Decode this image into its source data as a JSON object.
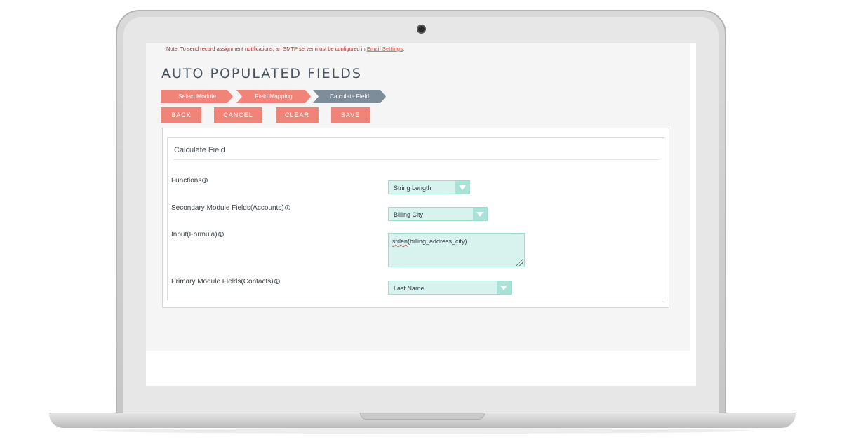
{
  "note": {
    "text": "Note: To send record assignment notifications, an SMTP server must be configured in",
    "link": "Email Settings",
    "suffix": "."
  },
  "page_title": "AUTO POPULATED FIELDS",
  "steps": [
    {
      "label": "Select Module",
      "state": "done"
    },
    {
      "label": "Field Mapping",
      "state": "done"
    },
    {
      "label": "Calculate Field",
      "state": "active"
    }
  ],
  "buttons": {
    "back": "BACK",
    "cancel": "CANCEL",
    "clear": "CLEAR",
    "save": "SAVE"
  },
  "panel": {
    "title": "Calculate Field",
    "fields": {
      "functions": {
        "label": "Functions",
        "value": "String Length"
      },
      "secondary": {
        "label": "Secondary Module Fields(Accounts)",
        "value": "Billing City"
      },
      "input": {
        "label": "Input(Formula)",
        "value_fn": "strlen",
        "value_args": "(billing_address_city)"
      },
      "primary": {
        "label": "Primary Module Fields(Contacts)",
        "value": "Last Name"
      }
    },
    "info_glyph": "i"
  },
  "colors": {
    "accent": "#f08478",
    "step_active": "#7e8d9a",
    "field_bg": "#d8f3ee",
    "field_border": "#9fdccf",
    "note_text": "#a0362f"
  },
  "icons": [
    "info-icon",
    "chevron-down-icon",
    "resize-handle-icon",
    "camera-icon"
  ]
}
